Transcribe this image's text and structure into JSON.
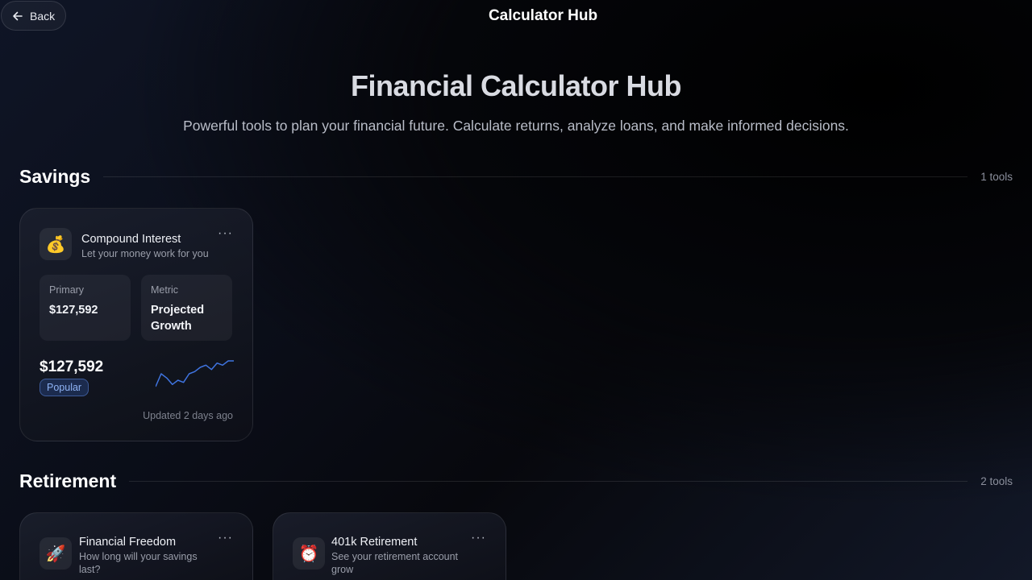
{
  "header": {
    "back_label": "Back",
    "app_title": "Calculator Hub"
  },
  "hero": {
    "title": "Financial Calculator Hub",
    "subtitle": "Powerful tools to plan your financial future. Calculate returns, analyze loans, and make informed decisions."
  },
  "sections": [
    {
      "title": "Savings",
      "count": "1 tools",
      "cards": [
        {
          "icon": "money-bag-icon",
          "icon_glyph": "💰",
          "title": "Compound Interest",
          "description": "Let your money work for you",
          "more_label": "···",
          "stats": [
            {
              "label": "Primary",
              "value": "$127,592"
            },
            {
              "label": "Metric",
              "value": "Projected Growth"
            }
          ],
          "big_value": "$127,592",
          "badge": "Popular",
          "updated": "Updated 2 days ago",
          "sparkline": [
            2,
            8,
            6,
            3,
            5,
            4,
            8,
            9,
            11,
            12,
            10,
            13,
            12,
            14,
            14
          ]
        }
      ]
    },
    {
      "title": "Retirement",
      "count": "2 tools",
      "cards": [
        {
          "icon": "rocket-icon",
          "icon_glyph": "🚀",
          "title": "Financial Freedom",
          "description": "How long will your savings last?",
          "more_label": "···"
        },
        {
          "icon": "alarm-clock-icon",
          "icon_glyph": "⏰",
          "title": "401k Retirement",
          "description": "See your retirement account grow",
          "more_label": "···"
        }
      ]
    }
  ],
  "colors": {
    "accent": "#3b6fd6",
    "sparkline": "#3f74e0",
    "background": "#0a0d17"
  }
}
